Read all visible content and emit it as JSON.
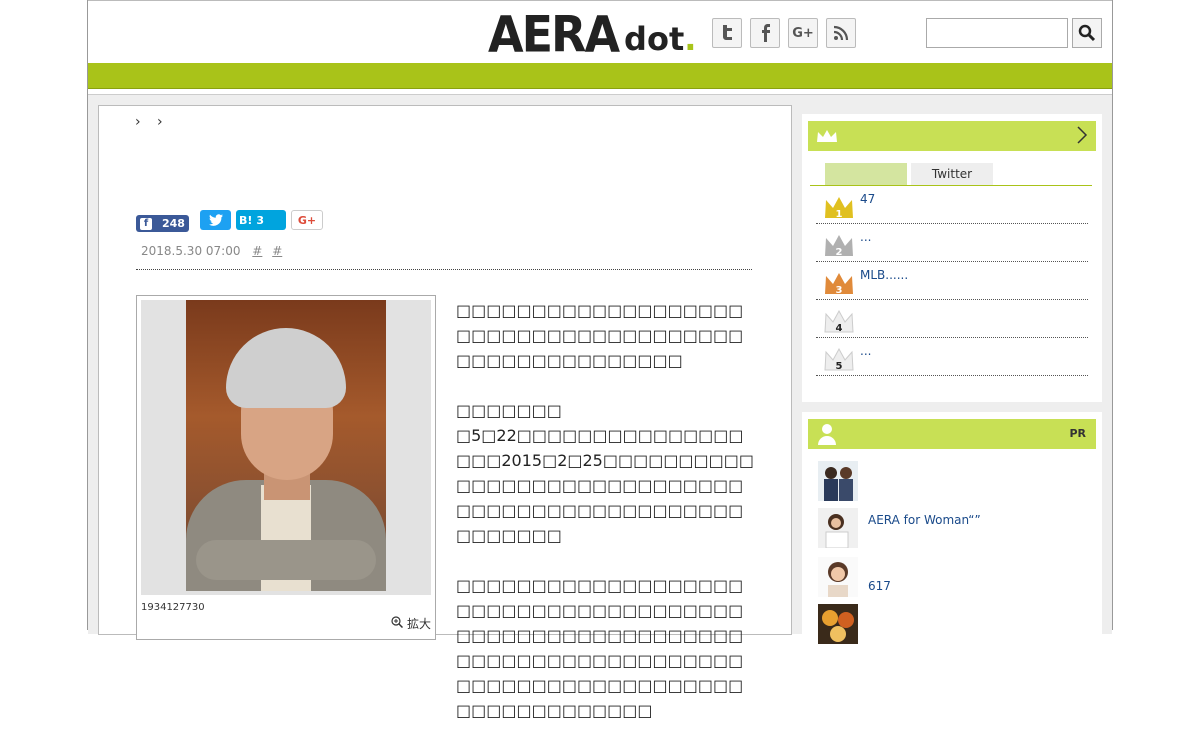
{
  "header": {
    "logo_main": "AERA",
    "logo_sub": "dot",
    "logo_period": ".",
    "social": {
      "twitter_glyph": "t",
      "facebook_glyph": "f",
      "googleplus_glyph": "G+",
      "rss_glyph": "rss"
    },
    "search": {
      "placeholder": ""
    }
  },
  "breadcrumb": {
    "separators": "› ›"
  },
  "share": {
    "facebook_glyph": "f",
    "facebook_count": "248",
    "twitter_glyph": "t",
    "hatena_label": "B!",
    "hatena_count": "3",
    "googleplus_label": "G+"
  },
  "article": {
    "date": "2018.5.30 07:00",
    "tag1": "#",
    "tag2": "#",
    "photo_id": "1934127730",
    "zoom_label": "拡大",
    "paragraphs": [
      "□□□□□□□□□□□□□□□□□□□□□□□□□□□□□□□□□□□□□□□□□□□□□□□□□□□□□",
      "□□□□□□□\n□5□22□□□□□□□□□□□□□□□□□□2015□2□25□□□□□□□□□□□□□□□□□□□□□□□□□□□□□□□□□□□□□□□□□□□□□□□□□□□□□□□",
      "□□□□□□□□□□□□□□□□□□□□□□□□□□□□□□□□□□□□□□□□□□□□□□□□□□□□□□□□□□□□□□□□□□□□□□□□□□□□□□□□□□□□□□□□□□□□□□□□□□□□□□□□□□□□"
    ]
  },
  "ranking": {
    "tabs": [
      "",
      "Twitter"
    ],
    "items": [
      {
        "rank": "1",
        "label": "47",
        "color": "#e0c020"
      },
      {
        "rank": "2",
        "label": "...",
        "color": "#b0b0b0"
      },
      {
        "rank": "3",
        "label": "MLB......",
        "color": "#e08a3a"
      },
      {
        "rank": "4",
        "label": "",
        "color": "#f0f0f0"
      },
      {
        "rank": "5",
        "label": "...",
        "color": "#f0f0f0"
      }
    ]
  },
  "pr": {
    "label": "PR",
    "items": [
      {
        "label": ""
      },
      {
        "label": "AERA for Woman“”"
      },
      {
        "label": "617"
      },
      {
        "label": ""
      }
    ]
  }
}
